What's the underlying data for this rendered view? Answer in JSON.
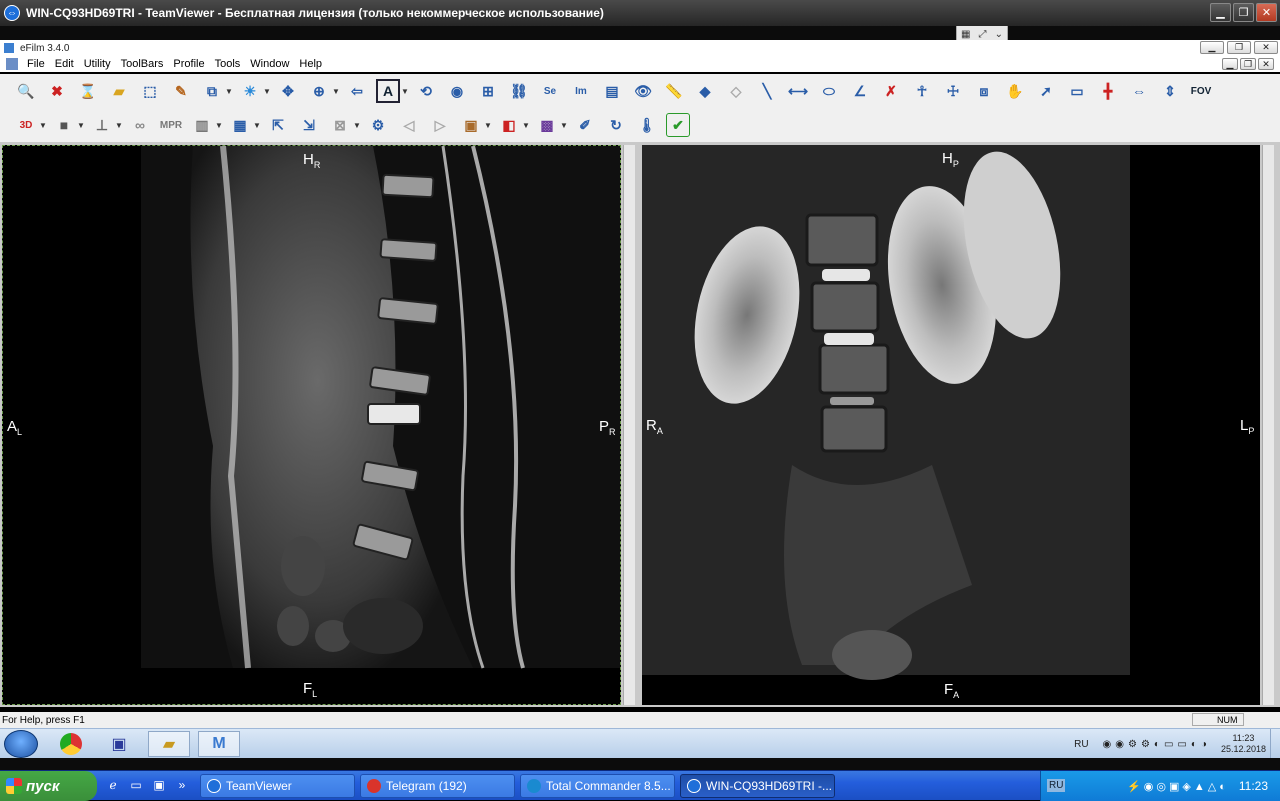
{
  "teamviewer": {
    "title": "WIN-CQ93HD69TRI - TeamViewer - Бесплатная лицензия (только некоммерческое использование)",
    "minimize": "▁",
    "restore": "❐",
    "close": "✕"
  },
  "efilm": {
    "title": "eFilm 3.4.0",
    "menu": [
      "File",
      "Edit",
      "Utility",
      "ToolBars",
      "Profile",
      "Tools",
      "Window",
      "Help"
    ],
    "toolbar_text": {
      "se": "Se",
      "im": "Im",
      "mpr": "MPR",
      "fov": "FOV",
      "three_d": "3D"
    }
  },
  "viewport_left": {
    "top": "H",
    "top_sub": "R",
    "bottom": "F",
    "bottom_sub": "L",
    "left": "A",
    "left_sub": "L",
    "right": "P",
    "right_sub": "R"
  },
  "viewport_right": {
    "top": "H",
    "top_sub": "P",
    "bottom": "F",
    "bottom_sub": "A",
    "left": "R",
    "left_sub": "A",
    "right": "L",
    "right_sub": "P"
  },
  "status": {
    "help": "For Help, press F1",
    "num": "NUM"
  },
  "remote_taskbar": {
    "lang": "RU",
    "time": "11:23",
    "date": "25.12.2018"
  },
  "xp_taskbar": {
    "start": "пуск",
    "tasks": [
      {
        "label": "TeamViewer",
        "color": "#1e6fd9"
      },
      {
        "label": "Telegram (192)",
        "color": "#d9342b"
      },
      {
        "label": "Total Commander 8.5...",
        "color": "#1a8ad0"
      },
      {
        "label": "WIN-CQ93HD69TRI -...",
        "color": "#1e6fd9"
      }
    ],
    "lang": "RU",
    "time": "11:23"
  }
}
